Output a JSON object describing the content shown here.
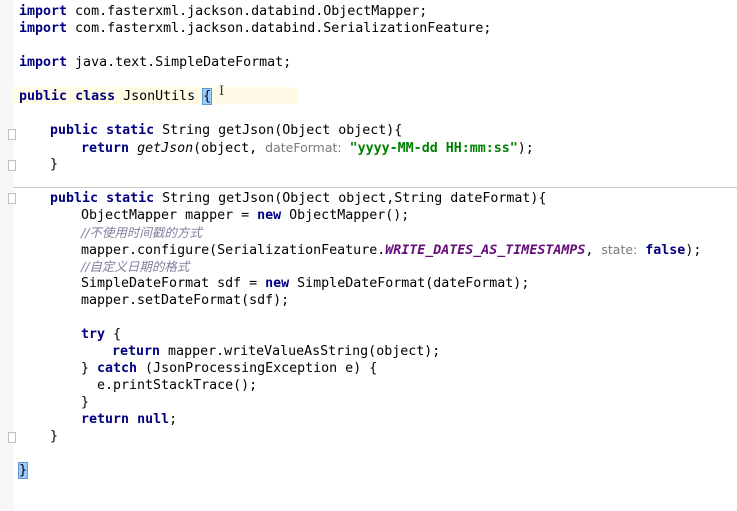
{
  "code": {
    "import1": {
      "kw": "import",
      "rest": " com.fasterxml.jackson.databind.ObjectMapper;"
    },
    "import2": {
      "kw": "import",
      "rest": " com.fasterxml.jackson.databind.SerializationFeature;"
    },
    "import3": {
      "kw": "import",
      "rest": " java.text.SimpleDateFormat;"
    },
    "class_decl": {
      "kw1": "public",
      "kw2": "class",
      "name": " JsonUtils ",
      "brace": "{"
    },
    "m1_sig": {
      "kw1": "public",
      "kw2": "static",
      "rest": " String getJson(Object object){"
    },
    "m1_ret": {
      "kw": "return",
      "call": "getJson",
      "args1": "(object, ",
      "hint": "dateFormat:",
      "str": "\"yyyy-MM-dd HH:mm:ss\"",
      "end": ");"
    },
    "close_brace": "}",
    "m2_sig": {
      "kw1": "public",
      "kw2": "static",
      "rest": " String getJson(Object object,String dateFormat){"
    },
    "mapper_decl": {
      "pre": "ObjectMapper mapper = ",
      "kw": "new",
      "post": " ObjectMapper();"
    },
    "comment1": "//不使用时间戳的方式",
    "configure": {
      "pre": "mapper.configure(SerializationFeature.",
      "field": "WRITE_DATES_AS_TIMESTAMPS",
      "mid": ", ",
      "hint": "state:",
      "kw": "false",
      "end": ");"
    },
    "comment2": "//自定义日期的格式",
    "sdf_decl": {
      "pre": "SimpleDateFormat sdf = ",
      "kw": "new",
      "post": " SimpleDateFormat(dateFormat);"
    },
    "set_format": "mapper.setDateFormat(sdf);",
    "try_line": {
      "kw": "try",
      "rest": " {"
    },
    "return_write": {
      "kw": "return",
      "rest": " mapper.writeValueAsString(object);"
    },
    "catch_line": {
      "pre": "} ",
      "kw": "catch",
      "rest": " (JsonProcessingException e) {"
    },
    "print_trace": "e.printStackTrace();",
    "return_null": {
      "kw1": "return",
      "kw2": "null",
      "end": ";"
    },
    "text_cursor": "I"
  },
  "colors": {
    "keyword": "#000080",
    "string": "#008000",
    "comment": "#8080a0",
    "param_hint": "#7a7a7a",
    "static_field": "#660e7a",
    "brace_highlight": "#99ccff",
    "current_line": "#fffbe6"
  },
  "icons": [
    "fold-marker-icon",
    "text-cursor-icon"
  ]
}
